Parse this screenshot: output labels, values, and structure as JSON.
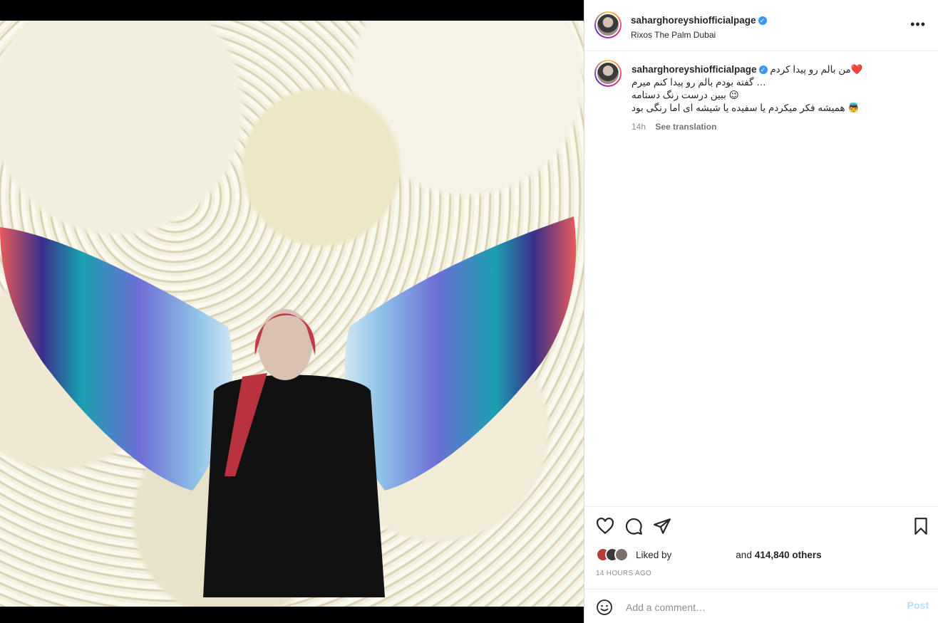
{
  "post": {
    "username": "saharghoreyshiofficialpage",
    "location": "Rixos The Palm Dubai",
    "verified_mark": "✓"
  },
  "caption": {
    "line1": "❤️من بالم رو پیدا کردم",
    "line2": "… گفته بودم بالم رو پیدا کنم میرم",
    "line3": "😉 ببین درست رنگ دستامه",
    "line4": "👼 همیشه فکر میکردم یا سفیده یا شیشه ای اما رنگی بود",
    "age": "14h",
    "see_translation": "See translation"
  },
  "likes": {
    "liked_by_label": "Liked by",
    "and_label": "and",
    "count": "414,840 others"
  },
  "timestamp": "14 HOURS AGO",
  "comment": {
    "placeholder": "Add a comment…",
    "post_label": "Post"
  },
  "icons": {
    "like": "heart-icon",
    "comment": "comment-icon",
    "share": "share-icon",
    "save": "bookmark-icon",
    "emoji": "emoji-icon",
    "more": "more-options-icon"
  },
  "colors": {
    "verified": "#3897f0",
    "post_button": "#b2dffc",
    "muted_text": "#8e8e8e"
  }
}
